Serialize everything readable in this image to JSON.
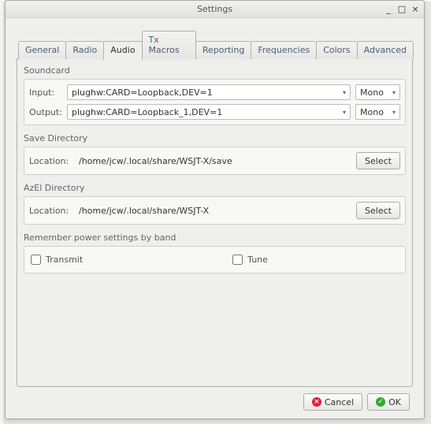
{
  "window": {
    "title": "Settings",
    "min": "_",
    "max": "□",
    "close": "×"
  },
  "tabs": {
    "general": "General",
    "radio": "Radio",
    "audio": "Audio",
    "txmacros": "Tx Macros",
    "reporting": "Reporting",
    "frequencies": "Frequencies",
    "colors": "Colors",
    "advanced": "Advanced"
  },
  "soundcard": {
    "title": "Soundcard",
    "input_label": "Input:",
    "input_value": "plughw:CARD=Loopback,DEV=1",
    "input_mode": "Mono",
    "output_label": "Output:",
    "output_value": "plughw:CARD=Loopback_1,DEV=1",
    "output_mode": "Mono"
  },
  "save_dir": {
    "title": "Save Directory",
    "location_label": "Location:",
    "location_value": "/home/jcw/.local/share/WSJT-X/save",
    "select": "Select"
  },
  "azel_dir": {
    "title": "AzEl Directory",
    "location_label": "Location:",
    "location_value": "/home/jcw/.local/share/WSJT-X",
    "select": "Select"
  },
  "power": {
    "title": "Remember power settings by band",
    "transmit": "Transmit",
    "tune": "Tune"
  },
  "buttons": {
    "cancel": "Cancel",
    "ok": "OK"
  }
}
